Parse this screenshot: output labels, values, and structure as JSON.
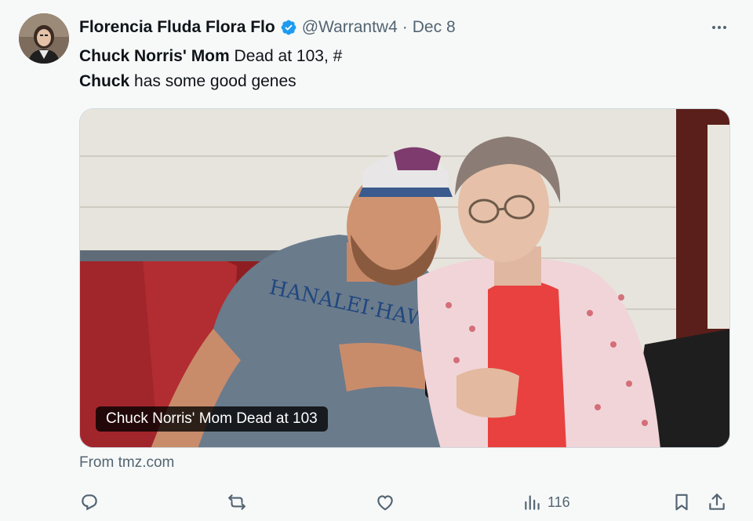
{
  "tweet": {
    "display_name": "Florencia Fluda Flora Flo",
    "handle": "@Warrantw4",
    "separator": "·",
    "date": "Dec 8",
    "text_part1_bold": "Chuck Norris' Mom",
    "text_part1_rest": " Dead at 103, #",
    "text_part2_bold": "Chuck",
    "text_part2_rest": " has some good genes",
    "media_caption": "Chuck Norris' Mom Dead at 103",
    "source": "From tmz.com",
    "views_count": "116"
  },
  "icons": {
    "verified": "verified-badge-icon",
    "more": "more-dots-icon",
    "reply": "reply-icon",
    "retweet": "retweet-icon",
    "like": "like-icon",
    "views": "views-icon",
    "bookmark": "bookmark-icon",
    "share": "share-icon"
  },
  "colors": {
    "verified_blue": "#1d9bf0",
    "text_primary": "#0f1419",
    "text_secondary": "#536471",
    "background": "#f7f9f9"
  }
}
